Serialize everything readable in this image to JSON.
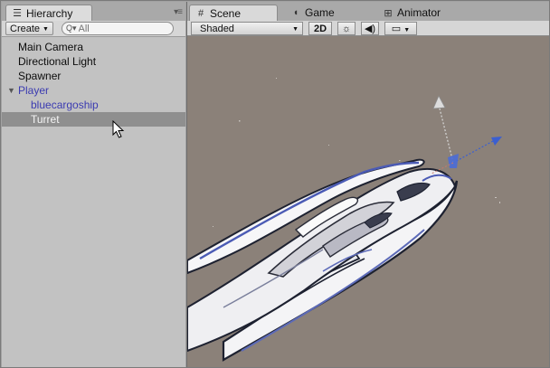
{
  "hierarchy": {
    "tab_label": "Hierarchy",
    "create_label": "Create",
    "search_placeholder": "All",
    "items": [
      {
        "label": "Main Camera"
      },
      {
        "label": "Directional Light"
      },
      {
        "label": "Spawner"
      },
      {
        "label": "Player"
      },
      {
        "label": "bluecargoship"
      },
      {
        "label": "Turret"
      }
    ]
  },
  "scene": {
    "tabs": [
      {
        "label": "Scene",
        "icon": "grid-icon"
      },
      {
        "label": "Game",
        "icon": "pacman-icon"
      },
      {
        "label": "Animator",
        "icon": "animator-icon"
      }
    ],
    "shading_mode": "Shaded",
    "mode_2d_label": "2D",
    "viewport_color": "#8b8179"
  },
  "colors": {
    "hierarchy_bg": "#c2c2c2",
    "selection_bg": "#8f8f8f",
    "prefab_blue": "#3b3bb1"
  }
}
